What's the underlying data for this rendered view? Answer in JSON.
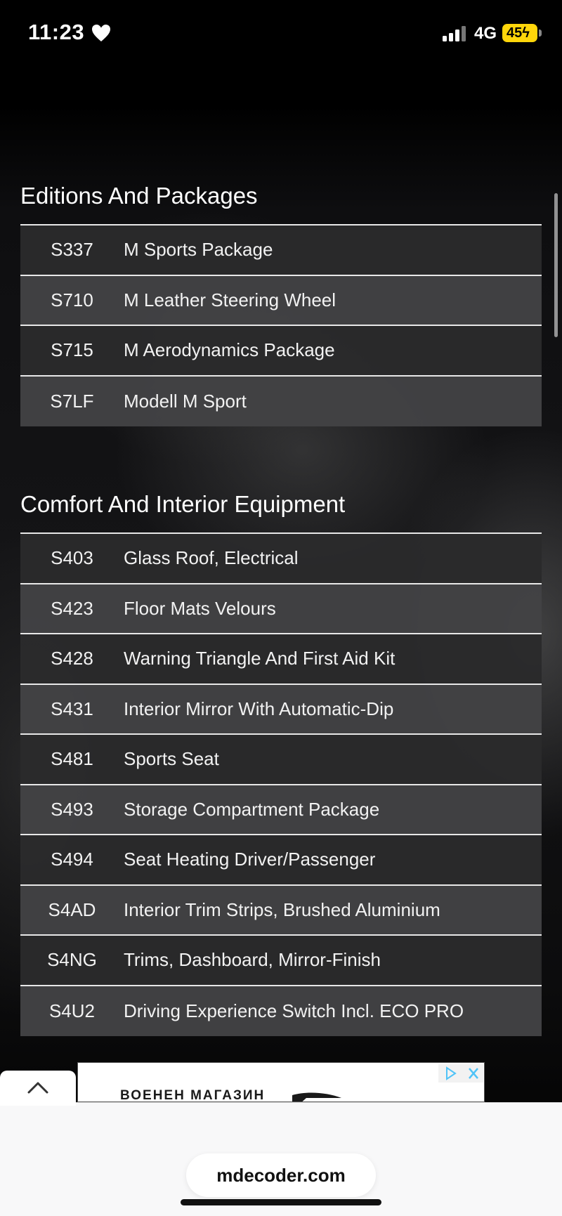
{
  "status_bar": {
    "time": "11:23",
    "network": "4G",
    "battery": "45"
  },
  "sections": [
    {
      "title": "Editions And Packages",
      "rows": [
        {
          "code": "S337",
          "description": "M Sports Package"
        },
        {
          "code": "S710",
          "description": "M Leather Steering Wheel"
        },
        {
          "code": "S715",
          "description": "M Aerodynamics Package"
        },
        {
          "code": "S7LF",
          "description": "Modell M Sport"
        }
      ]
    },
    {
      "title": "Comfort And Interior Equipment",
      "rows": [
        {
          "code": "S403",
          "description": "Glass Roof, Electrical"
        },
        {
          "code": "S423",
          "description": "Floor Mats Velours"
        },
        {
          "code": "S428",
          "description": "Warning Triangle And First Aid Kit"
        },
        {
          "code": "S431",
          "description": "Interior Mirror With Automatic-Dip"
        },
        {
          "code": "S481",
          "description": "Sports Seat"
        },
        {
          "code": "S493",
          "description": "Storage Compartment Package"
        },
        {
          "code": "S494",
          "description": "Seat Heating Driver/Passenger"
        },
        {
          "code": "S4AD",
          "description": "Interior Trim Strips, Brushed Aluminium"
        },
        {
          "code": "S4NG",
          "description": "Trims, Dashboard, Mirror-Finish"
        },
        {
          "code": "S4U2",
          "description": "Driving Experience Switch Incl. ECO PRO"
        }
      ]
    }
  ],
  "ad": {
    "text": "ВОЕНЕН МАГАЗИН"
  },
  "browser": {
    "url": "mdecoder.com"
  },
  "colors": {
    "row_dark": "#2a2a2b",
    "row_light": "#424244",
    "divider": "#e8e8e8",
    "battery": "#ffd60a"
  }
}
